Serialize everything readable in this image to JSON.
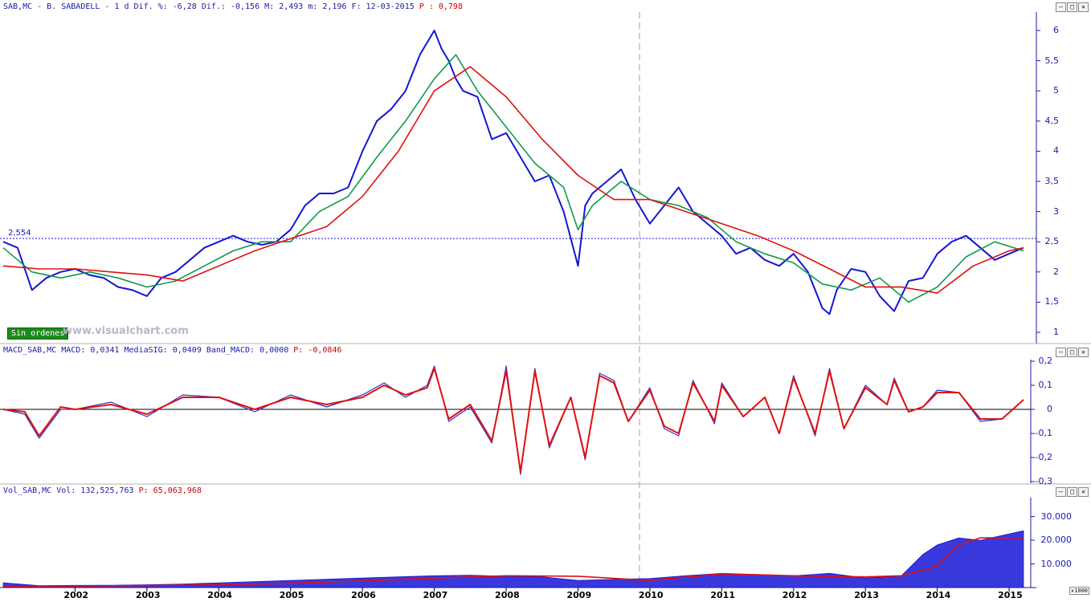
{
  "price_panel": {
    "header": "SAB,MC - B. SABADELL -  1 d Dif. %: -6,28 Dif.: -0,156 M: 2,493 m: 2,196 F: 12-03-2015",
    "header_p": "P : 0,798",
    "reference_label": "2,554",
    "badge": "Sin ordenes",
    "watermark": "www.visualchart.com"
  },
  "macd_panel": {
    "header": "MACD_SAB,MC MACD: 0,0341 MediaSIG: 0,0409 Band_MACD: 0,0000",
    "header_p": "P: -0,0846"
  },
  "volume_panel": {
    "header": "Vol_SAB,MC Vol: 132,525,763",
    "header_p": "P: 65,063,968",
    "unit_label": "x1000"
  },
  "window_buttons": [
    "–",
    "□",
    "✕"
  ],
  "colors": {
    "price": "#1515d6",
    "ma_fast": "#109a4a",
    "ma_slow": "#e01010",
    "signal": "#e01010",
    "macd": "#3030c8",
    "volume": "#1515d6",
    "vol_ma_slow": "#e01010",
    "vol_ma_fast": "#109a9a",
    "axis_text": "#1a1aa8"
  },
  "chart_data": [
    {
      "type": "line",
      "name": "price",
      "x_ticks": [
        "2002",
        "2003",
        "2004",
        "2005",
        "2006",
        "2007",
        "2008",
        "2009",
        "2010",
        "2011",
        "2012",
        "2013",
        "2014",
        "2015"
      ],
      "ylim": [
        0.8,
        6.2
      ],
      "y_ticks": [
        "1",
        "1,5",
        "2",
        "2,5",
        "3",
        "3,5",
        "4",
        "4,5",
        "5",
        "5,5",
        "6"
      ],
      "reference_line": 2.554,
      "series": [
        {
          "key": "price",
          "x": [
            2001.0,
            2001.2,
            2001.4,
            2001.6,
            2001.8,
            2002.0,
            2002.2,
            2002.4,
            2002.6,
            2002.8,
            2003.0,
            2003.2,
            2003.4,
            2003.6,
            2003.8,
            2004.0,
            2004.2,
            2004.4,
            2004.6,
            2004.8,
            2005.0,
            2005.2,
            2005.4,
            2005.6,
            2005.8,
            2006.0,
            2006.2,
            2006.4,
            2006.6,
            2006.8,
            2007.0,
            2007.1,
            2007.2,
            2007.3,
            2007.4,
            2007.6,
            2007.8,
            2008.0,
            2008.2,
            2008.4,
            2008.6,
            2008.8,
            2009.0,
            2009.1,
            2009.2,
            2009.4,
            2009.6,
            2009.8,
            2010.0,
            2010.2,
            2010.4,
            2010.6,
            2010.8,
            2011.0,
            2011.2,
            2011.4,
            2011.6,
            2011.8,
            2012.0,
            2012.2,
            2012.4,
            2012.5,
            2012.6,
            2012.8,
            2013.0,
            2013.2,
            2013.4,
            2013.6,
            2013.8,
            2014.0,
            2014.2,
            2014.4,
            2014.6,
            2014.8,
            2015.0,
            2015.2
          ],
          "y": [
            2.5,
            2.4,
            1.7,
            1.9,
            2.0,
            2.05,
            1.95,
            1.9,
            1.75,
            1.7,
            1.6,
            1.9,
            2.0,
            2.2,
            2.4,
            2.5,
            2.6,
            2.5,
            2.45,
            2.5,
            2.7,
            3.1,
            3.3,
            3.3,
            3.4,
            4.0,
            4.5,
            4.7,
            5.0,
            5.6,
            6.0,
            5.7,
            5.5,
            5.2,
            5.0,
            4.9,
            4.2,
            4.3,
            3.9,
            3.5,
            3.6,
            3.0,
            2.1,
            3.1,
            3.3,
            3.5,
            3.7,
            3.2,
            2.8,
            3.1,
            3.4,
            3.0,
            2.8,
            2.6,
            2.3,
            2.4,
            2.2,
            2.1,
            2.3,
            2.0,
            1.4,
            1.3,
            1.7,
            2.05,
            2.0,
            1.6,
            1.35,
            1.85,
            1.9,
            2.3,
            2.5,
            2.6,
            2.4,
            2.2,
            2.3,
            2.4
          ]
        },
        {
          "key": "ma_fast",
          "x": [
            2001.0,
            2001.4,
            2001.8,
            2002.2,
            2002.6,
            2003.0,
            2003.4,
            2003.8,
            2004.2,
            2004.6,
            2005.0,
            2005.4,
            2005.8,
            2006.2,
            2006.6,
            2007.0,
            2007.3,
            2007.6,
            2008.0,
            2008.4,
            2008.8,
            2009.0,
            2009.2,
            2009.6,
            2010.0,
            2010.4,
            2010.8,
            2011.2,
            2011.6,
            2012.0,
            2012.4,
            2012.8,
            2013.2,
            2013.6,
            2014.0,
            2014.4,
            2014.8,
            2015.2
          ],
          "y": [
            2.4,
            2.0,
            1.9,
            2.0,
            1.9,
            1.75,
            1.85,
            2.1,
            2.35,
            2.5,
            2.5,
            3.0,
            3.25,
            3.9,
            4.5,
            5.2,
            5.6,
            5.0,
            4.4,
            3.8,
            3.4,
            2.7,
            3.1,
            3.5,
            3.2,
            3.1,
            2.9,
            2.5,
            2.3,
            2.15,
            1.8,
            1.7,
            1.9,
            1.5,
            1.75,
            2.25,
            2.5,
            2.35
          ]
        },
        {
          "key": "ma_slow",
          "x": [
            2001.0,
            2001.5,
            2002.0,
            2002.5,
            2003.0,
            2003.5,
            2004.0,
            2004.5,
            2005.0,
            2005.5,
            2006.0,
            2006.5,
            2007.0,
            2007.5,
            2008.0,
            2008.5,
            2009.0,
            2009.5,
            2010.0,
            2010.5,
            2011.0,
            2011.5,
            2012.0,
            2012.5,
            2013.0,
            2013.5,
            2014.0,
            2014.5,
            2015.0,
            2015.2
          ],
          "y": [
            2.1,
            2.05,
            2.05,
            2.0,
            1.95,
            1.85,
            2.1,
            2.35,
            2.55,
            2.75,
            3.25,
            4.0,
            5.0,
            5.4,
            4.9,
            4.2,
            3.6,
            3.2,
            3.2,
            3.0,
            2.8,
            2.6,
            2.35,
            2.05,
            1.75,
            1.75,
            1.65,
            2.1,
            2.35,
            2.4
          ]
        }
      ]
    },
    {
      "type": "line",
      "name": "macd",
      "ylim": [
        -0.3,
        0.2
      ],
      "y_ticks": [
        "0,2",
        "0,1",
        "0",
        "-0,1",
        "-0,2",
        "-0,3"
      ],
      "series": [
        {
          "key": "macd",
          "x": [
            2001.0,
            2001.3,
            2001.5,
            2001.8,
            2002.0,
            2002.5,
            2003.0,
            2003.5,
            2004.0,
            2004.5,
            2005.0,
            2005.5,
            2006.0,
            2006.3,
            2006.6,
            2006.9,
            2007.0,
            2007.2,
            2007.5,
            2007.8,
            2008.0,
            2008.2,
            2008.4,
            2008.6,
            2008.9,
            2009.1,
            2009.3,
            2009.5,
            2009.7,
            2010.0,
            2010.2,
            2010.4,
            2010.6,
            2010.9,
            2011.0,
            2011.3,
            2011.6,
            2011.8,
            2012.0,
            2012.3,
            2012.5,
            2012.7,
            2013.0,
            2013.3,
            2013.4,
            2013.6,
            2013.8,
            2014.0,
            2014.3,
            2014.6,
            2014.9,
            2015.2
          ],
          "y": [
            0,
            -0.02,
            -0.12,
            0,
            0,
            0.03,
            -0.03,
            0.06,
            0.05,
            -0.01,
            0.06,
            0.01,
            0.06,
            0.11,
            0.05,
            0.1,
            0.18,
            -0.05,
            0.01,
            -0.14,
            0.18,
            -0.27,
            0.17,
            -0.16,
            0.05,
            -0.21,
            0.15,
            0.12,
            -0.05,
            0.09,
            -0.08,
            -0.11,
            0.12,
            -0.06,
            0.11,
            -0.03,
            0.05,
            -0.1,
            0.14,
            -0.11,
            0.17,
            -0.08,
            0.1,
            0.02,
            0.13,
            -0.01,
            0.01,
            0.08,
            0.07,
            -0.05,
            -0.04,
            0.04
          ]
        },
        {
          "key": "signal",
          "x": [
            2001.0,
            2001.3,
            2001.5,
            2001.8,
            2002.0,
            2002.5,
            2003.0,
            2003.5,
            2004.0,
            2004.5,
            2005.0,
            2005.5,
            2006.0,
            2006.3,
            2006.6,
            2006.9,
            2007.0,
            2007.2,
            2007.5,
            2007.8,
            2008.0,
            2008.2,
            2008.4,
            2008.6,
            2008.9,
            2009.1,
            2009.3,
            2009.5,
            2009.7,
            2010.0,
            2010.2,
            2010.4,
            2010.6,
            2010.9,
            2011.0,
            2011.3,
            2011.6,
            2011.8,
            2012.0,
            2012.3,
            2012.5,
            2012.7,
            2013.0,
            2013.3,
            2013.4,
            2013.6,
            2013.8,
            2014.0,
            2014.3,
            2014.6,
            2014.9,
            2015.2
          ],
          "y": [
            0,
            -0.01,
            -0.11,
            0.01,
            0,
            0.02,
            -0.02,
            0.05,
            0.05,
            0,
            0.05,
            0.02,
            0.05,
            0.1,
            0.06,
            0.09,
            0.17,
            -0.04,
            0.02,
            -0.13,
            0.16,
            -0.26,
            0.16,
            -0.15,
            0.05,
            -0.2,
            0.14,
            0.11,
            -0.05,
            0.08,
            -0.07,
            -0.1,
            0.11,
            -0.05,
            0.1,
            -0.03,
            0.05,
            -0.1,
            0.13,
            -0.1,
            0.16,
            -0.08,
            0.09,
            0.02,
            0.12,
            -0.01,
            0.01,
            0.07,
            0.07,
            -0.04,
            -0.04,
            0.04
          ]
        }
      ]
    },
    {
      "type": "bar",
      "name": "volume",
      "ylim": [
        0,
        38000
      ],
      "y_ticks": [
        "30.000",
        "20.000",
        "10.000"
      ],
      "series": [
        {
          "key": "volume",
          "x": [
            2001.0,
            2001.5,
            2002.0,
            2002.5,
            2003.0,
            2003.5,
            2004.0,
            2004.5,
            2005.0,
            2005.5,
            2006.0,
            2006.5,
            2007.0,
            2007.5,
            2008.0,
            2008.5,
            2009.0,
            2009.5,
            2010.0,
            2010.5,
            2011.0,
            2011.5,
            2012.0,
            2012.5,
            2013.0,
            2013.5,
            2013.8,
            2014.0,
            2014.3,
            2014.6,
            2014.9,
            2015.2
          ],
          "y": [
            2000,
            800,
            900,
            1000,
            1200,
            1500,
            2000,
            2500,
            3000,
            3500,
            4000,
            4500,
            5000,
            5200,
            4800,
            4500,
            3000,
            3500,
            3800,
            5000,
            6000,
            5500,
            5000,
            6000,
            4000,
            5000,
            14000,
            18000,
            21000,
            20000,
            22000,
            24000
          ]
        },
        {
          "key": "vol_ma_slow",
          "x": [
            2001.0,
            2002.0,
            2003.0,
            2004.0,
            2005.0,
            2006.0,
            2007.0,
            2008.0,
            2009.0,
            2010.0,
            2011.0,
            2012.0,
            2013.0,
            2013.5,
            2014.0,
            2014.3,
            2014.6,
            2015.2
          ],
          "y": [
            500,
            600,
            800,
            1200,
            1800,
            2800,
            4000,
            5000,
            4800,
            3000,
            5800,
            5000,
            4500,
            5000,
            9000,
            18000,
            21000,
            21000
          ]
        }
      ]
    }
  ]
}
